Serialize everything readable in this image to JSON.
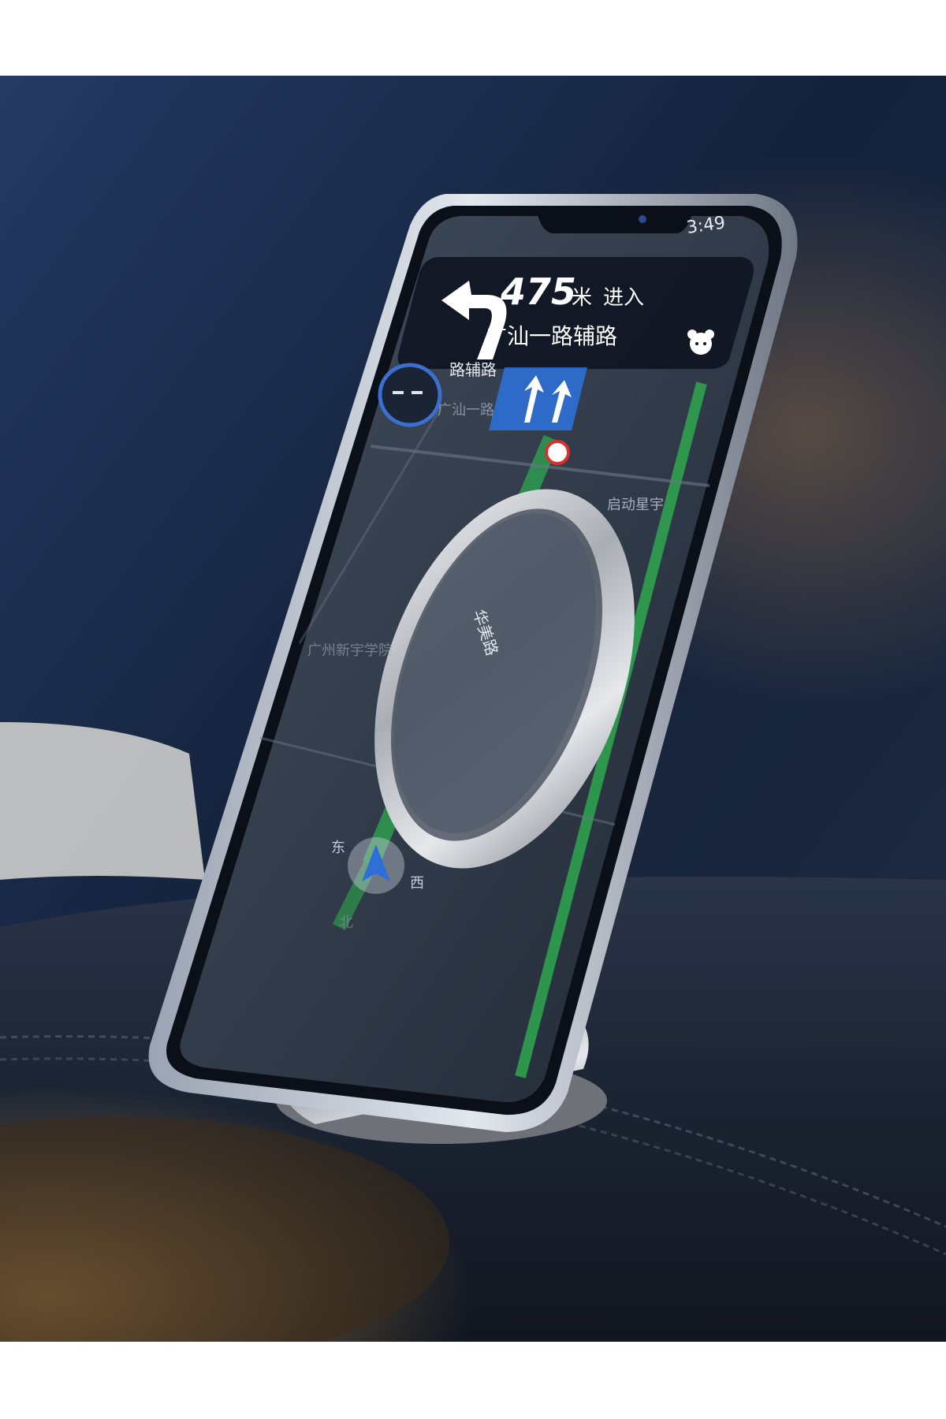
{
  "navigation": {
    "distance_number": "475",
    "distance_unit": "米",
    "action": "进入",
    "road": "广汕一路辅路",
    "status_time": "3:49",
    "road_label_top": "路辅路",
    "road_label_side": "广汕一路",
    "road_label_vertical": "华美路",
    "poi_1": "启动星宇",
    "poi_2": "广州新宇学院",
    "compass_e": "东",
    "compass_w": "西",
    "compass_n": "北"
  },
  "colors": {
    "background_top": "#1d2f4f",
    "background_bottom": "#0c1220",
    "route_green": "#2ea84f",
    "sign_blue": "#2d6fd6",
    "nav_card": "#0f1522",
    "mount_silver": "#c9ccd1",
    "dashboard": "#1a2231"
  },
  "icons": {
    "turn_arrow": "turn-left-arrow-icon",
    "mascot": "bear-face-icon",
    "locator": "navigation-arrow-icon"
  }
}
